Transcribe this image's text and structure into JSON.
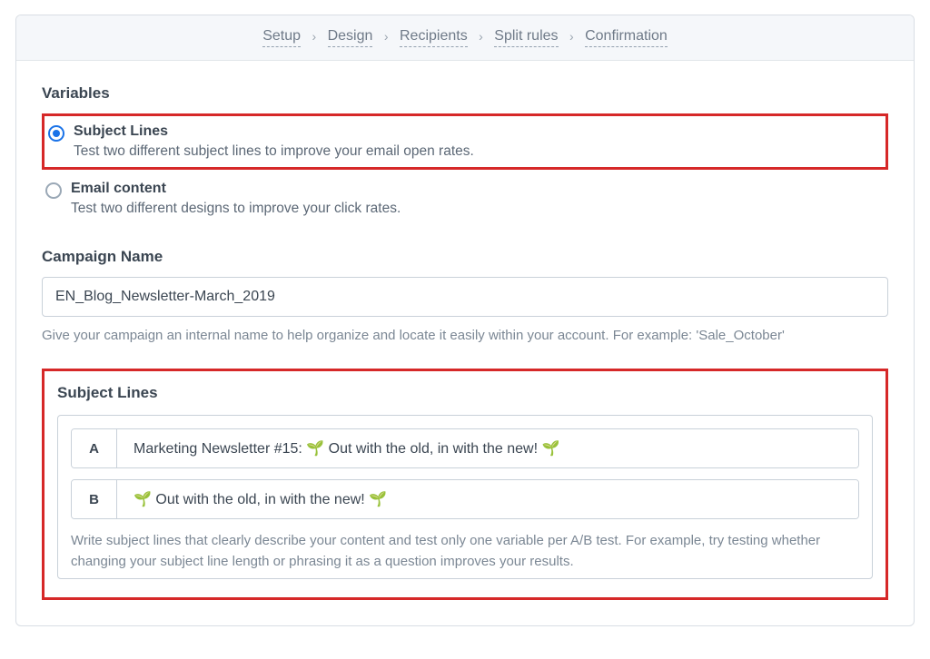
{
  "breadcrumb": {
    "items": [
      "Setup",
      "Design",
      "Recipients",
      "Split rules",
      "Confirmation"
    ]
  },
  "variables": {
    "heading": "Variables",
    "options": [
      {
        "label": "Subject Lines",
        "desc": "Test two different subject lines to improve your email open rates.",
        "selected": true
      },
      {
        "label": "Email content",
        "desc": "Test two different designs to improve your click rates.",
        "selected": false
      }
    ]
  },
  "campaign": {
    "label": "Campaign Name",
    "value": "EN_Blog_Newsletter-March_2019",
    "helper": "Give your campaign an internal name to help organize and locate it easily within your account. For example: 'Sale_October'"
  },
  "subject": {
    "heading": "Subject Lines",
    "rows": [
      {
        "tag": "A",
        "value": "Marketing Newsletter #15: 🌱 Out with the old, in with the new! 🌱"
      },
      {
        "tag": "B",
        "value": "🌱 Out with the old, in with the new! 🌱"
      }
    ],
    "helper": "Write subject lines that clearly describe your content and test only one variable per A/B test. For example, try testing whether changing your subject line length or phrasing it as a question improves your results."
  }
}
